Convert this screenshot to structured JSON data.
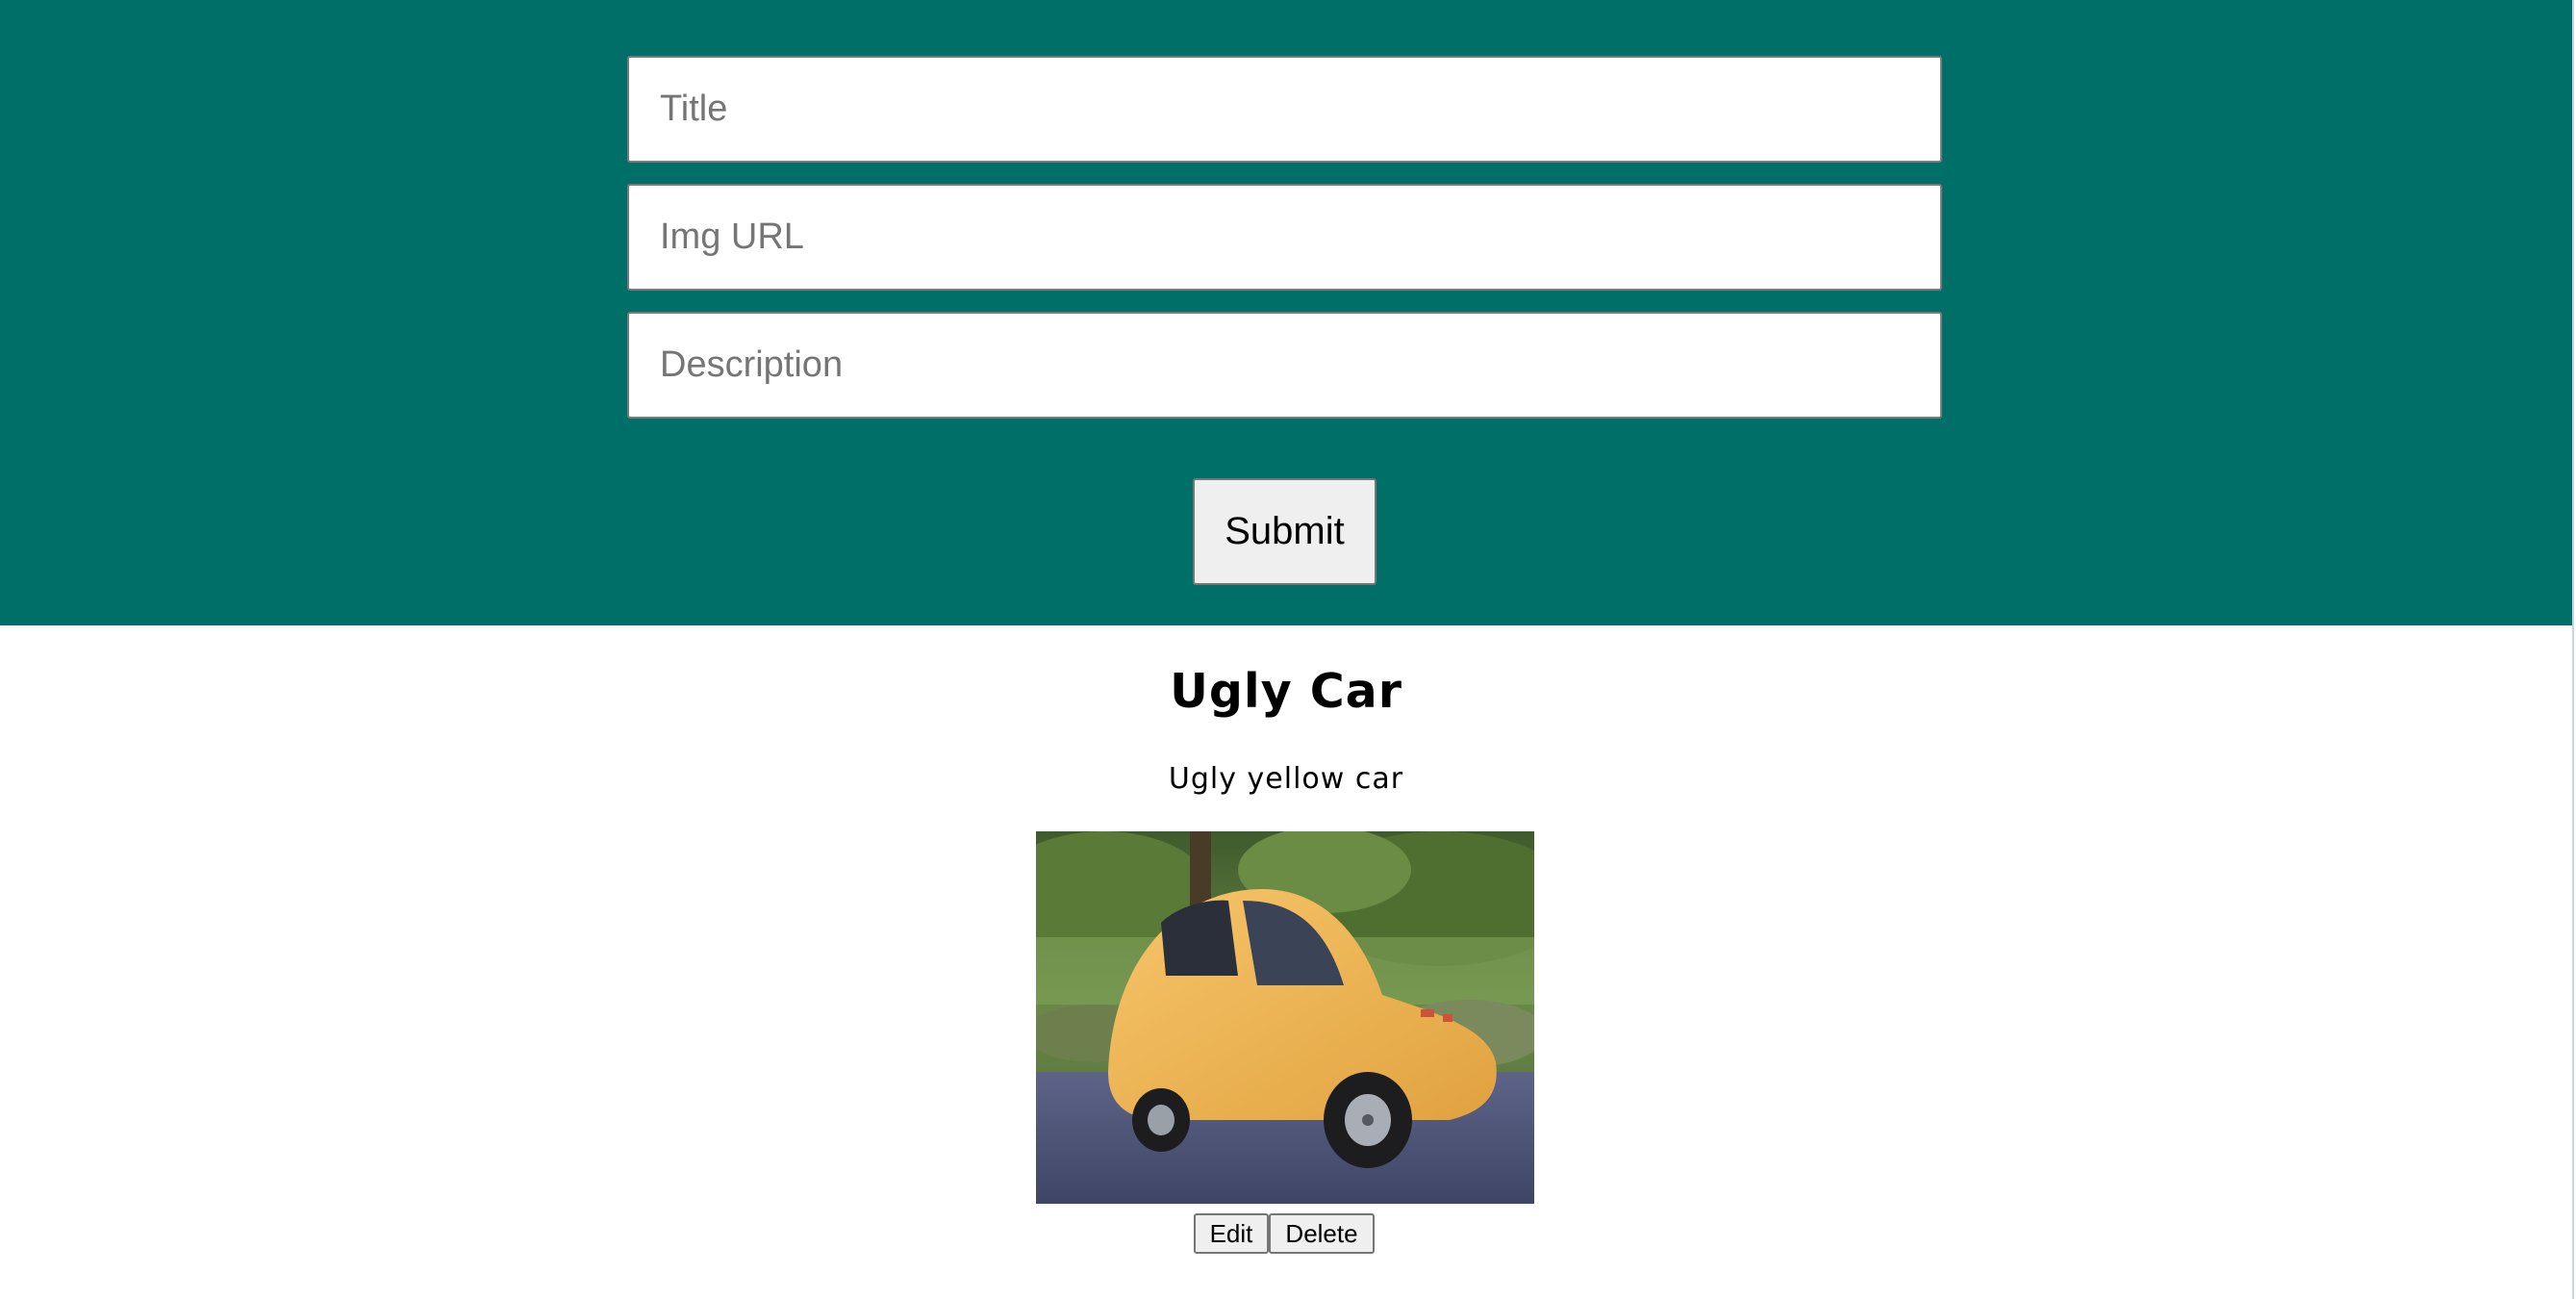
{
  "form": {
    "title_placeholder": "Title",
    "img_url_placeholder": "Img URL",
    "description_placeholder": "Description",
    "submit_label": "Submit"
  },
  "post": {
    "title": "Ugly Car",
    "description": "Ugly yellow car",
    "edit_label": "Edit",
    "delete_label": "Delete"
  },
  "colors": {
    "form_background": "#006f68",
    "page_background": "#ffffff",
    "button_background": "#efefef"
  }
}
